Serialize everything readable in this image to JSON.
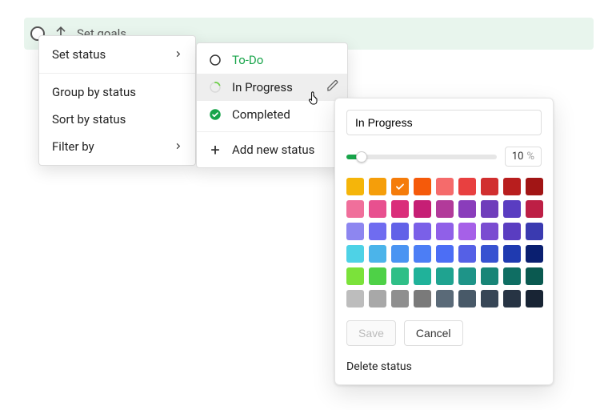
{
  "task": {
    "title": "Set goals"
  },
  "menu1": {
    "set_status": "Set status",
    "group_by": "Group by status",
    "sort_by": "Sort by status",
    "filter_by": "Filter by"
  },
  "menu2": {
    "todo": "To-Do",
    "in_progress": "In Progress",
    "completed": "Completed",
    "add_new": "Add new status"
  },
  "popover": {
    "name_value": "In Progress",
    "percent_value": "10",
    "percent_symbol": "%",
    "save": "Save",
    "cancel": "Cancel",
    "delete": "Delete status",
    "swatches": [
      [
        "#f5b50a",
        "#f59e0a",
        "#f57c0a",
        "#f55a0a",
        "#f56b6b",
        "#e84040",
        "#d12f2f",
        "#b81e1e",
        "#a11515"
      ],
      [
        "#f06f9b",
        "#e8508f",
        "#da2e7a",
        "#c61f75",
        "#b23a9a",
        "#8a3dbb",
        "#6f3dbb",
        "#5a3dc1",
        "#bd1f45"
      ],
      [
        "#8d86f0",
        "#6f6cf0",
        "#6262e8",
        "#7a60e8",
        "#9060e8",
        "#a660e8",
        "#7a4cd1",
        "#5a3dc1",
        "#3a3ab0"
      ],
      [
        "#4ed2e6",
        "#4bb4ea",
        "#4a94f2",
        "#4c7ef5",
        "#4c6ef5",
        "#5560e6",
        "#3752d1",
        "#1f3ab0",
        "#0a1f70"
      ],
      [
        "#7be23a",
        "#4ed147",
        "#2fbf87",
        "#20b29a",
        "#1fa390",
        "#1e9488",
        "#188577",
        "#0f6e63",
        "#0a5950"
      ],
      [
        "#bdbdbd",
        "#a8a8a8",
        "#8f8f8f",
        "#7a7a7a",
        "#5a6a78",
        "#485968",
        "#374656",
        "#273444",
        "#182434"
      ]
    ],
    "selected_swatch": [
      0,
      2
    ]
  }
}
